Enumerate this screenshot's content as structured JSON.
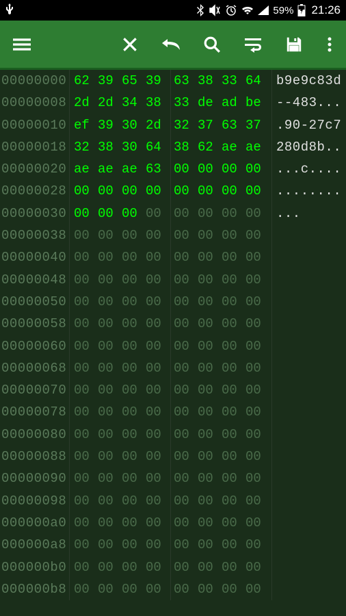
{
  "status_bar": {
    "battery_text": "59%",
    "time": "21:26"
  },
  "toolbar": {
    "menu": "menu",
    "close": "close",
    "undo": "undo",
    "search": "search",
    "wrap": "wrap",
    "save": "save",
    "more": "more"
  },
  "hex_rows": [
    {
      "offset": "00000000",
      "bytes": [
        "62",
        "39",
        "65",
        "39",
        "63",
        "38",
        "33",
        "64"
      ],
      "hl": [
        1,
        1,
        1,
        1,
        1,
        1,
        1,
        1
      ],
      "ascii": "b9e9c83d"
    },
    {
      "offset": "00000008",
      "bytes": [
        "2d",
        "2d",
        "34",
        "38",
        "33",
        "de",
        "ad",
        "be"
      ],
      "hl": [
        1,
        1,
        1,
        1,
        1,
        1,
        1,
        1
      ],
      "ascii": "--483..."
    },
    {
      "offset": "00000010",
      "bytes": [
        "ef",
        "39",
        "30",
        "2d",
        "32",
        "37",
        "63",
        "37"
      ],
      "hl": [
        1,
        1,
        1,
        1,
        1,
        1,
        1,
        1
      ],
      "ascii": ".90-27c7"
    },
    {
      "offset": "00000018",
      "bytes": [
        "32",
        "38",
        "30",
        "64",
        "38",
        "62",
        "ae",
        "ae"
      ],
      "hl": [
        1,
        1,
        1,
        1,
        1,
        1,
        1,
        1
      ],
      "ascii": "280d8b.."
    },
    {
      "offset": "00000020",
      "bytes": [
        "ae",
        "ae",
        "ae",
        "63",
        "00",
        "00",
        "00",
        "00"
      ],
      "hl": [
        1,
        1,
        1,
        1,
        1,
        1,
        1,
        1
      ],
      "ascii": "...c...."
    },
    {
      "offset": "00000028",
      "bytes": [
        "00",
        "00",
        "00",
        "00",
        "00",
        "00",
        "00",
        "00"
      ],
      "hl": [
        1,
        1,
        1,
        1,
        1,
        1,
        1,
        1
      ],
      "ascii": "........"
    },
    {
      "offset": "00000030",
      "bytes": [
        "00",
        "00",
        "00",
        "00",
        "00",
        "00",
        "00",
        "00"
      ],
      "hl": [
        1,
        1,
        1,
        0,
        0,
        0,
        0,
        0
      ],
      "ascii": "..."
    },
    {
      "offset": "00000038",
      "bytes": [
        "00",
        "00",
        "00",
        "00",
        "00",
        "00",
        "00",
        "00"
      ],
      "hl": [
        0,
        0,
        0,
        0,
        0,
        0,
        0,
        0
      ],
      "ascii": ""
    },
    {
      "offset": "00000040",
      "bytes": [
        "00",
        "00",
        "00",
        "00",
        "00",
        "00",
        "00",
        "00"
      ],
      "hl": [
        0,
        0,
        0,
        0,
        0,
        0,
        0,
        0
      ],
      "ascii": ""
    },
    {
      "offset": "00000048",
      "bytes": [
        "00",
        "00",
        "00",
        "00",
        "00",
        "00",
        "00",
        "00"
      ],
      "hl": [
        0,
        0,
        0,
        0,
        0,
        0,
        0,
        0
      ],
      "ascii": ""
    },
    {
      "offset": "00000050",
      "bytes": [
        "00",
        "00",
        "00",
        "00",
        "00",
        "00",
        "00",
        "00"
      ],
      "hl": [
        0,
        0,
        0,
        0,
        0,
        0,
        0,
        0
      ],
      "ascii": ""
    },
    {
      "offset": "00000058",
      "bytes": [
        "00",
        "00",
        "00",
        "00",
        "00",
        "00",
        "00",
        "00"
      ],
      "hl": [
        0,
        0,
        0,
        0,
        0,
        0,
        0,
        0
      ],
      "ascii": ""
    },
    {
      "offset": "00000060",
      "bytes": [
        "00",
        "00",
        "00",
        "00",
        "00",
        "00",
        "00",
        "00"
      ],
      "hl": [
        0,
        0,
        0,
        0,
        0,
        0,
        0,
        0
      ],
      "ascii": ""
    },
    {
      "offset": "00000068",
      "bytes": [
        "00",
        "00",
        "00",
        "00",
        "00",
        "00",
        "00",
        "00"
      ],
      "hl": [
        0,
        0,
        0,
        0,
        0,
        0,
        0,
        0
      ],
      "ascii": ""
    },
    {
      "offset": "00000070",
      "bytes": [
        "00",
        "00",
        "00",
        "00",
        "00",
        "00",
        "00",
        "00"
      ],
      "hl": [
        0,
        0,
        0,
        0,
        0,
        0,
        0,
        0
      ],
      "ascii": ""
    },
    {
      "offset": "00000078",
      "bytes": [
        "00",
        "00",
        "00",
        "00",
        "00",
        "00",
        "00",
        "00"
      ],
      "hl": [
        0,
        0,
        0,
        0,
        0,
        0,
        0,
        0
      ],
      "ascii": ""
    },
    {
      "offset": "00000080",
      "bytes": [
        "00",
        "00",
        "00",
        "00",
        "00",
        "00",
        "00",
        "00"
      ],
      "hl": [
        0,
        0,
        0,
        0,
        0,
        0,
        0,
        0
      ],
      "ascii": ""
    },
    {
      "offset": "00000088",
      "bytes": [
        "00",
        "00",
        "00",
        "00",
        "00",
        "00",
        "00",
        "00"
      ],
      "hl": [
        0,
        0,
        0,
        0,
        0,
        0,
        0,
        0
      ],
      "ascii": ""
    },
    {
      "offset": "00000090",
      "bytes": [
        "00",
        "00",
        "00",
        "00",
        "00",
        "00",
        "00",
        "00"
      ],
      "hl": [
        0,
        0,
        0,
        0,
        0,
        0,
        0,
        0
      ],
      "ascii": ""
    },
    {
      "offset": "00000098",
      "bytes": [
        "00",
        "00",
        "00",
        "00",
        "00",
        "00",
        "00",
        "00"
      ],
      "hl": [
        0,
        0,
        0,
        0,
        0,
        0,
        0,
        0
      ],
      "ascii": ""
    },
    {
      "offset": "000000a0",
      "bytes": [
        "00",
        "00",
        "00",
        "00",
        "00",
        "00",
        "00",
        "00"
      ],
      "hl": [
        0,
        0,
        0,
        0,
        0,
        0,
        0,
        0
      ],
      "ascii": ""
    },
    {
      "offset": "000000a8",
      "bytes": [
        "00",
        "00",
        "00",
        "00",
        "00",
        "00",
        "00",
        "00"
      ],
      "hl": [
        0,
        0,
        0,
        0,
        0,
        0,
        0,
        0
      ],
      "ascii": ""
    },
    {
      "offset": "000000b0",
      "bytes": [
        "00",
        "00",
        "00",
        "00",
        "00",
        "00",
        "00",
        "00"
      ],
      "hl": [
        0,
        0,
        0,
        0,
        0,
        0,
        0,
        0
      ],
      "ascii": ""
    },
    {
      "offset": "000000b8",
      "bytes": [
        "00",
        "00",
        "00",
        "00",
        "00",
        "00",
        "00",
        "00"
      ],
      "hl": [
        0,
        0,
        0,
        0,
        0,
        0,
        0,
        0
      ],
      "ascii": ""
    }
  ]
}
